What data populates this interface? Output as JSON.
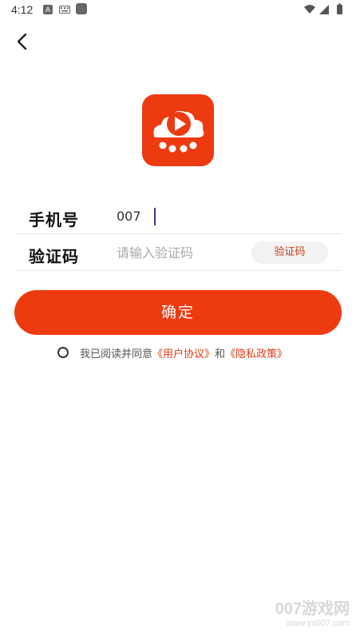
{
  "status_bar": {
    "time": "4:12",
    "a_icon_letter": "A"
  },
  "nav": {
    "back_icon": "chevron-left-icon"
  },
  "logo": {
    "icon": "video-cloud-logo-icon",
    "color": "#ee3a11"
  },
  "form": {
    "phone": {
      "label": "手机号",
      "value": "007"
    },
    "code": {
      "label": "验证码",
      "placeholder": "请输入验证码",
      "button_label": "验证码"
    }
  },
  "confirm_label": "确定",
  "agreement": {
    "prefix": "我已阅读并同意",
    "user_agreement": "《用户协议》",
    "and": "和",
    "privacy_policy": "《隐私政策》"
  },
  "watermark": {
    "title": "007游戏网",
    "url": "www.yx007.com"
  },
  "colors": {
    "accent": "#ee3a11",
    "link": "#e03a12"
  }
}
